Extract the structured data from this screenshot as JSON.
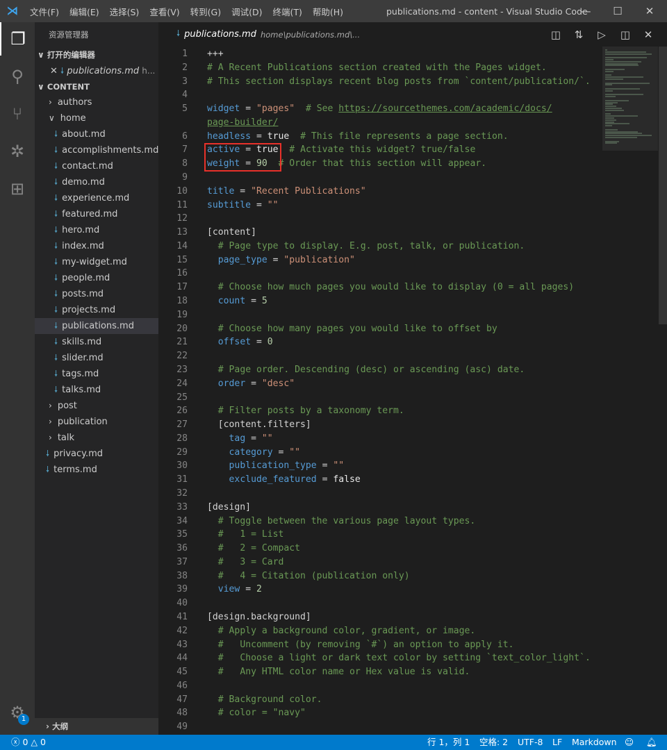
{
  "titlebar": {
    "menus": [
      "文件(F)",
      "编辑(E)",
      "选择(S)",
      "查看(V)",
      "转到(G)",
      "调试(D)",
      "终端(T)",
      "帮助(H)"
    ],
    "title": "publications.md - content - Visual Studio Code"
  },
  "sidebar": {
    "title": "资源管理器",
    "open_editors_label": "打开的编辑器",
    "open_editor": {
      "name": "publications.md",
      "path": "h..."
    },
    "folder_label": "CONTENT",
    "tree": [
      {
        "name": "authors",
        "type": "folder",
        "depth": 0
      },
      {
        "name": "home",
        "type": "folder-open",
        "depth": 0
      },
      {
        "name": "about.md",
        "type": "file",
        "depth": 1
      },
      {
        "name": "accomplishments.md",
        "type": "file",
        "depth": 1
      },
      {
        "name": "contact.md",
        "type": "file",
        "depth": 1
      },
      {
        "name": "demo.md",
        "type": "file",
        "depth": 1
      },
      {
        "name": "experience.md",
        "type": "file",
        "depth": 1
      },
      {
        "name": "featured.md",
        "type": "file",
        "depth": 1
      },
      {
        "name": "hero.md",
        "type": "file",
        "depth": 1
      },
      {
        "name": "index.md",
        "type": "file",
        "depth": 1
      },
      {
        "name": "my-widget.md",
        "type": "file",
        "depth": 1
      },
      {
        "name": "people.md",
        "type": "file",
        "depth": 1
      },
      {
        "name": "posts.md",
        "type": "file",
        "depth": 1
      },
      {
        "name": "projects.md",
        "type": "file",
        "depth": 1
      },
      {
        "name": "publications.md",
        "type": "file",
        "depth": 1,
        "selected": true
      },
      {
        "name": "skills.md",
        "type": "file",
        "depth": 1
      },
      {
        "name": "slider.md",
        "type": "file",
        "depth": 1
      },
      {
        "name": "tags.md",
        "type": "file",
        "depth": 1
      },
      {
        "name": "talks.md",
        "type": "file",
        "depth": 1
      },
      {
        "name": "post",
        "type": "folder",
        "depth": 0
      },
      {
        "name": "publication",
        "type": "folder",
        "depth": 0
      },
      {
        "name": "talk",
        "type": "folder",
        "depth": 0
      },
      {
        "name": "privacy.md",
        "type": "file",
        "depth": 0
      },
      {
        "name": "terms.md",
        "type": "file",
        "depth": 0
      }
    ],
    "outline_label": "大纲"
  },
  "activity": {
    "settings_badge": "1"
  },
  "tab": {
    "name": "publications.md",
    "path": "home\\publications.md\\..."
  },
  "editor": {
    "lines": [
      {
        "n": "1",
        "t": [
          [
            "p",
            "+++"
          ]
        ]
      },
      {
        "n": "2",
        "t": [
          [
            "c",
            "# A Recent Publications section created with the Pages widget."
          ]
        ]
      },
      {
        "n": "3",
        "t": [
          [
            "c",
            "# This section displays recent blog posts from `content/publication/`."
          ]
        ]
      },
      {
        "n": "4",
        "t": []
      },
      {
        "n": "5",
        "t": [
          [
            "k",
            "widget"
          ],
          [
            "p",
            " = "
          ],
          [
            "s",
            "\"pages\""
          ],
          [
            "p",
            "  "
          ],
          [
            "c",
            "# See "
          ],
          [
            "l",
            "https://sourcethemes.com/academic/docs/"
          ]
        ]
      },
      {
        "n": "",
        "t": [
          [
            "l",
            "page-builder/"
          ]
        ]
      },
      {
        "n": "6",
        "t": [
          [
            "k",
            "headless"
          ],
          [
            "p",
            " = "
          ],
          [
            "b",
            "true"
          ],
          [
            "p",
            "  "
          ],
          [
            "c",
            "# This file represents a page section."
          ]
        ]
      },
      {
        "n": "7",
        "t": [
          [
            "k",
            "active"
          ],
          [
            "p",
            " = "
          ],
          [
            "b",
            "true"
          ],
          [
            "p",
            "  "
          ],
          [
            "c",
            "# Activate this widget? true/false"
          ]
        ]
      },
      {
        "n": "8",
        "t": [
          [
            "k",
            "weight"
          ],
          [
            "p",
            " = "
          ],
          [
            "n",
            "90"
          ],
          [
            "p",
            "  "
          ],
          [
            "c",
            "# Order that this section will appear."
          ]
        ]
      },
      {
        "n": "9",
        "t": []
      },
      {
        "n": "10",
        "t": [
          [
            "k",
            "title"
          ],
          [
            "p",
            " = "
          ],
          [
            "s",
            "\"Recent Publications\""
          ]
        ]
      },
      {
        "n": "11",
        "t": [
          [
            "k",
            "subtitle"
          ],
          [
            "p",
            " = "
          ],
          [
            "s",
            "\"\""
          ]
        ]
      },
      {
        "n": "12",
        "t": []
      },
      {
        "n": "13",
        "t": [
          [
            "h",
            "[content]"
          ]
        ]
      },
      {
        "n": "14",
        "t": [
          [
            "p",
            "  "
          ],
          [
            "c",
            "# Page type to display. E.g. post, talk, or publication."
          ]
        ]
      },
      {
        "n": "15",
        "t": [
          [
            "p",
            "  "
          ],
          [
            "k",
            "page_type"
          ],
          [
            "p",
            " = "
          ],
          [
            "s",
            "\"publication\""
          ]
        ]
      },
      {
        "n": "16",
        "t": []
      },
      {
        "n": "17",
        "t": [
          [
            "p",
            "  "
          ],
          [
            "c",
            "# Choose how much pages you would like to display (0 = all pages)"
          ]
        ]
      },
      {
        "n": "18",
        "t": [
          [
            "p",
            "  "
          ],
          [
            "k",
            "count"
          ],
          [
            "p",
            " = "
          ],
          [
            "n",
            "5"
          ]
        ]
      },
      {
        "n": "19",
        "t": []
      },
      {
        "n": "20",
        "t": [
          [
            "p",
            "  "
          ],
          [
            "c",
            "# Choose how many pages you would like to offset by"
          ]
        ]
      },
      {
        "n": "21",
        "t": [
          [
            "p",
            "  "
          ],
          [
            "k",
            "offset"
          ],
          [
            "p",
            " = "
          ],
          [
            "n",
            "0"
          ]
        ]
      },
      {
        "n": "22",
        "t": []
      },
      {
        "n": "23",
        "t": [
          [
            "p",
            "  "
          ],
          [
            "c",
            "# Page order. Descending (desc) or ascending (asc) date."
          ]
        ]
      },
      {
        "n": "24",
        "t": [
          [
            "p",
            "  "
          ],
          [
            "k",
            "order"
          ],
          [
            "p",
            " = "
          ],
          [
            "s",
            "\"desc\""
          ]
        ]
      },
      {
        "n": "25",
        "t": []
      },
      {
        "n": "26",
        "t": [
          [
            "p",
            "  "
          ],
          [
            "c",
            "# Filter posts by a taxonomy term."
          ]
        ]
      },
      {
        "n": "27",
        "t": [
          [
            "p",
            "  "
          ],
          [
            "h",
            "[content.filters]"
          ]
        ]
      },
      {
        "n": "28",
        "t": [
          [
            "p",
            "    "
          ],
          [
            "k",
            "tag"
          ],
          [
            "p",
            " = "
          ],
          [
            "s",
            "\"\""
          ]
        ]
      },
      {
        "n": "29",
        "t": [
          [
            "p",
            "    "
          ],
          [
            "k",
            "category"
          ],
          [
            "p",
            " = "
          ],
          [
            "s",
            "\"\""
          ]
        ]
      },
      {
        "n": "30",
        "t": [
          [
            "p",
            "    "
          ],
          [
            "k",
            "publication_type"
          ],
          [
            "p",
            " = "
          ],
          [
            "s",
            "\"\""
          ]
        ]
      },
      {
        "n": "31",
        "t": [
          [
            "p",
            "    "
          ],
          [
            "k",
            "exclude_featured"
          ],
          [
            "p",
            " = "
          ],
          [
            "b",
            "false"
          ]
        ]
      },
      {
        "n": "32",
        "t": []
      },
      {
        "n": "33",
        "t": [
          [
            "h",
            "[design]"
          ]
        ]
      },
      {
        "n": "34",
        "t": [
          [
            "p",
            "  "
          ],
          [
            "c",
            "# Toggle between the various page layout types."
          ]
        ]
      },
      {
        "n": "35",
        "t": [
          [
            "p",
            "  "
          ],
          [
            "c",
            "#   1 = List"
          ]
        ]
      },
      {
        "n": "36",
        "t": [
          [
            "p",
            "  "
          ],
          [
            "c",
            "#   2 = Compact"
          ]
        ]
      },
      {
        "n": "37",
        "t": [
          [
            "p",
            "  "
          ],
          [
            "c",
            "#   3 = Card"
          ]
        ]
      },
      {
        "n": "38",
        "t": [
          [
            "p",
            "  "
          ],
          [
            "c",
            "#   4 = Citation (publication only)"
          ]
        ]
      },
      {
        "n": "39",
        "t": [
          [
            "p",
            "  "
          ],
          [
            "k",
            "view"
          ],
          [
            "p",
            " = "
          ],
          [
            "n",
            "2"
          ]
        ]
      },
      {
        "n": "40",
        "t": []
      },
      {
        "n": "41",
        "t": [
          [
            "h",
            "[design.background]"
          ]
        ]
      },
      {
        "n": "42",
        "t": [
          [
            "p",
            "  "
          ],
          [
            "c",
            "# Apply a background color, gradient, or image."
          ]
        ]
      },
      {
        "n": "43",
        "t": [
          [
            "p",
            "  "
          ],
          [
            "c",
            "#   Uncomment (by removing `#`) an option to apply it."
          ]
        ]
      },
      {
        "n": "44",
        "t": [
          [
            "p",
            "  "
          ],
          [
            "c",
            "#   Choose a light or dark text color by setting `text_color_light`."
          ]
        ]
      },
      {
        "n": "45",
        "t": [
          [
            "p",
            "  "
          ],
          [
            "c",
            "#   Any HTML color name or Hex value is valid."
          ]
        ]
      },
      {
        "n": "46",
        "t": []
      },
      {
        "n": "47",
        "t": [
          [
            "p",
            "  "
          ],
          [
            "c",
            "# Background color."
          ]
        ]
      },
      {
        "n": "48",
        "t": [
          [
            "p",
            "  "
          ],
          [
            "c",
            "# color = \"navy\""
          ]
        ]
      },
      {
        "n": "49",
        "t": []
      }
    ]
  },
  "status": {
    "errors": "0",
    "warnings": "0",
    "position": "行 1，列 1",
    "spaces": "空格: 2",
    "encoding": "UTF-8",
    "eol": "LF",
    "language": "Markdown"
  },
  "colors": {
    "accent": "#007acc",
    "highlight_box": "#e8312a"
  }
}
